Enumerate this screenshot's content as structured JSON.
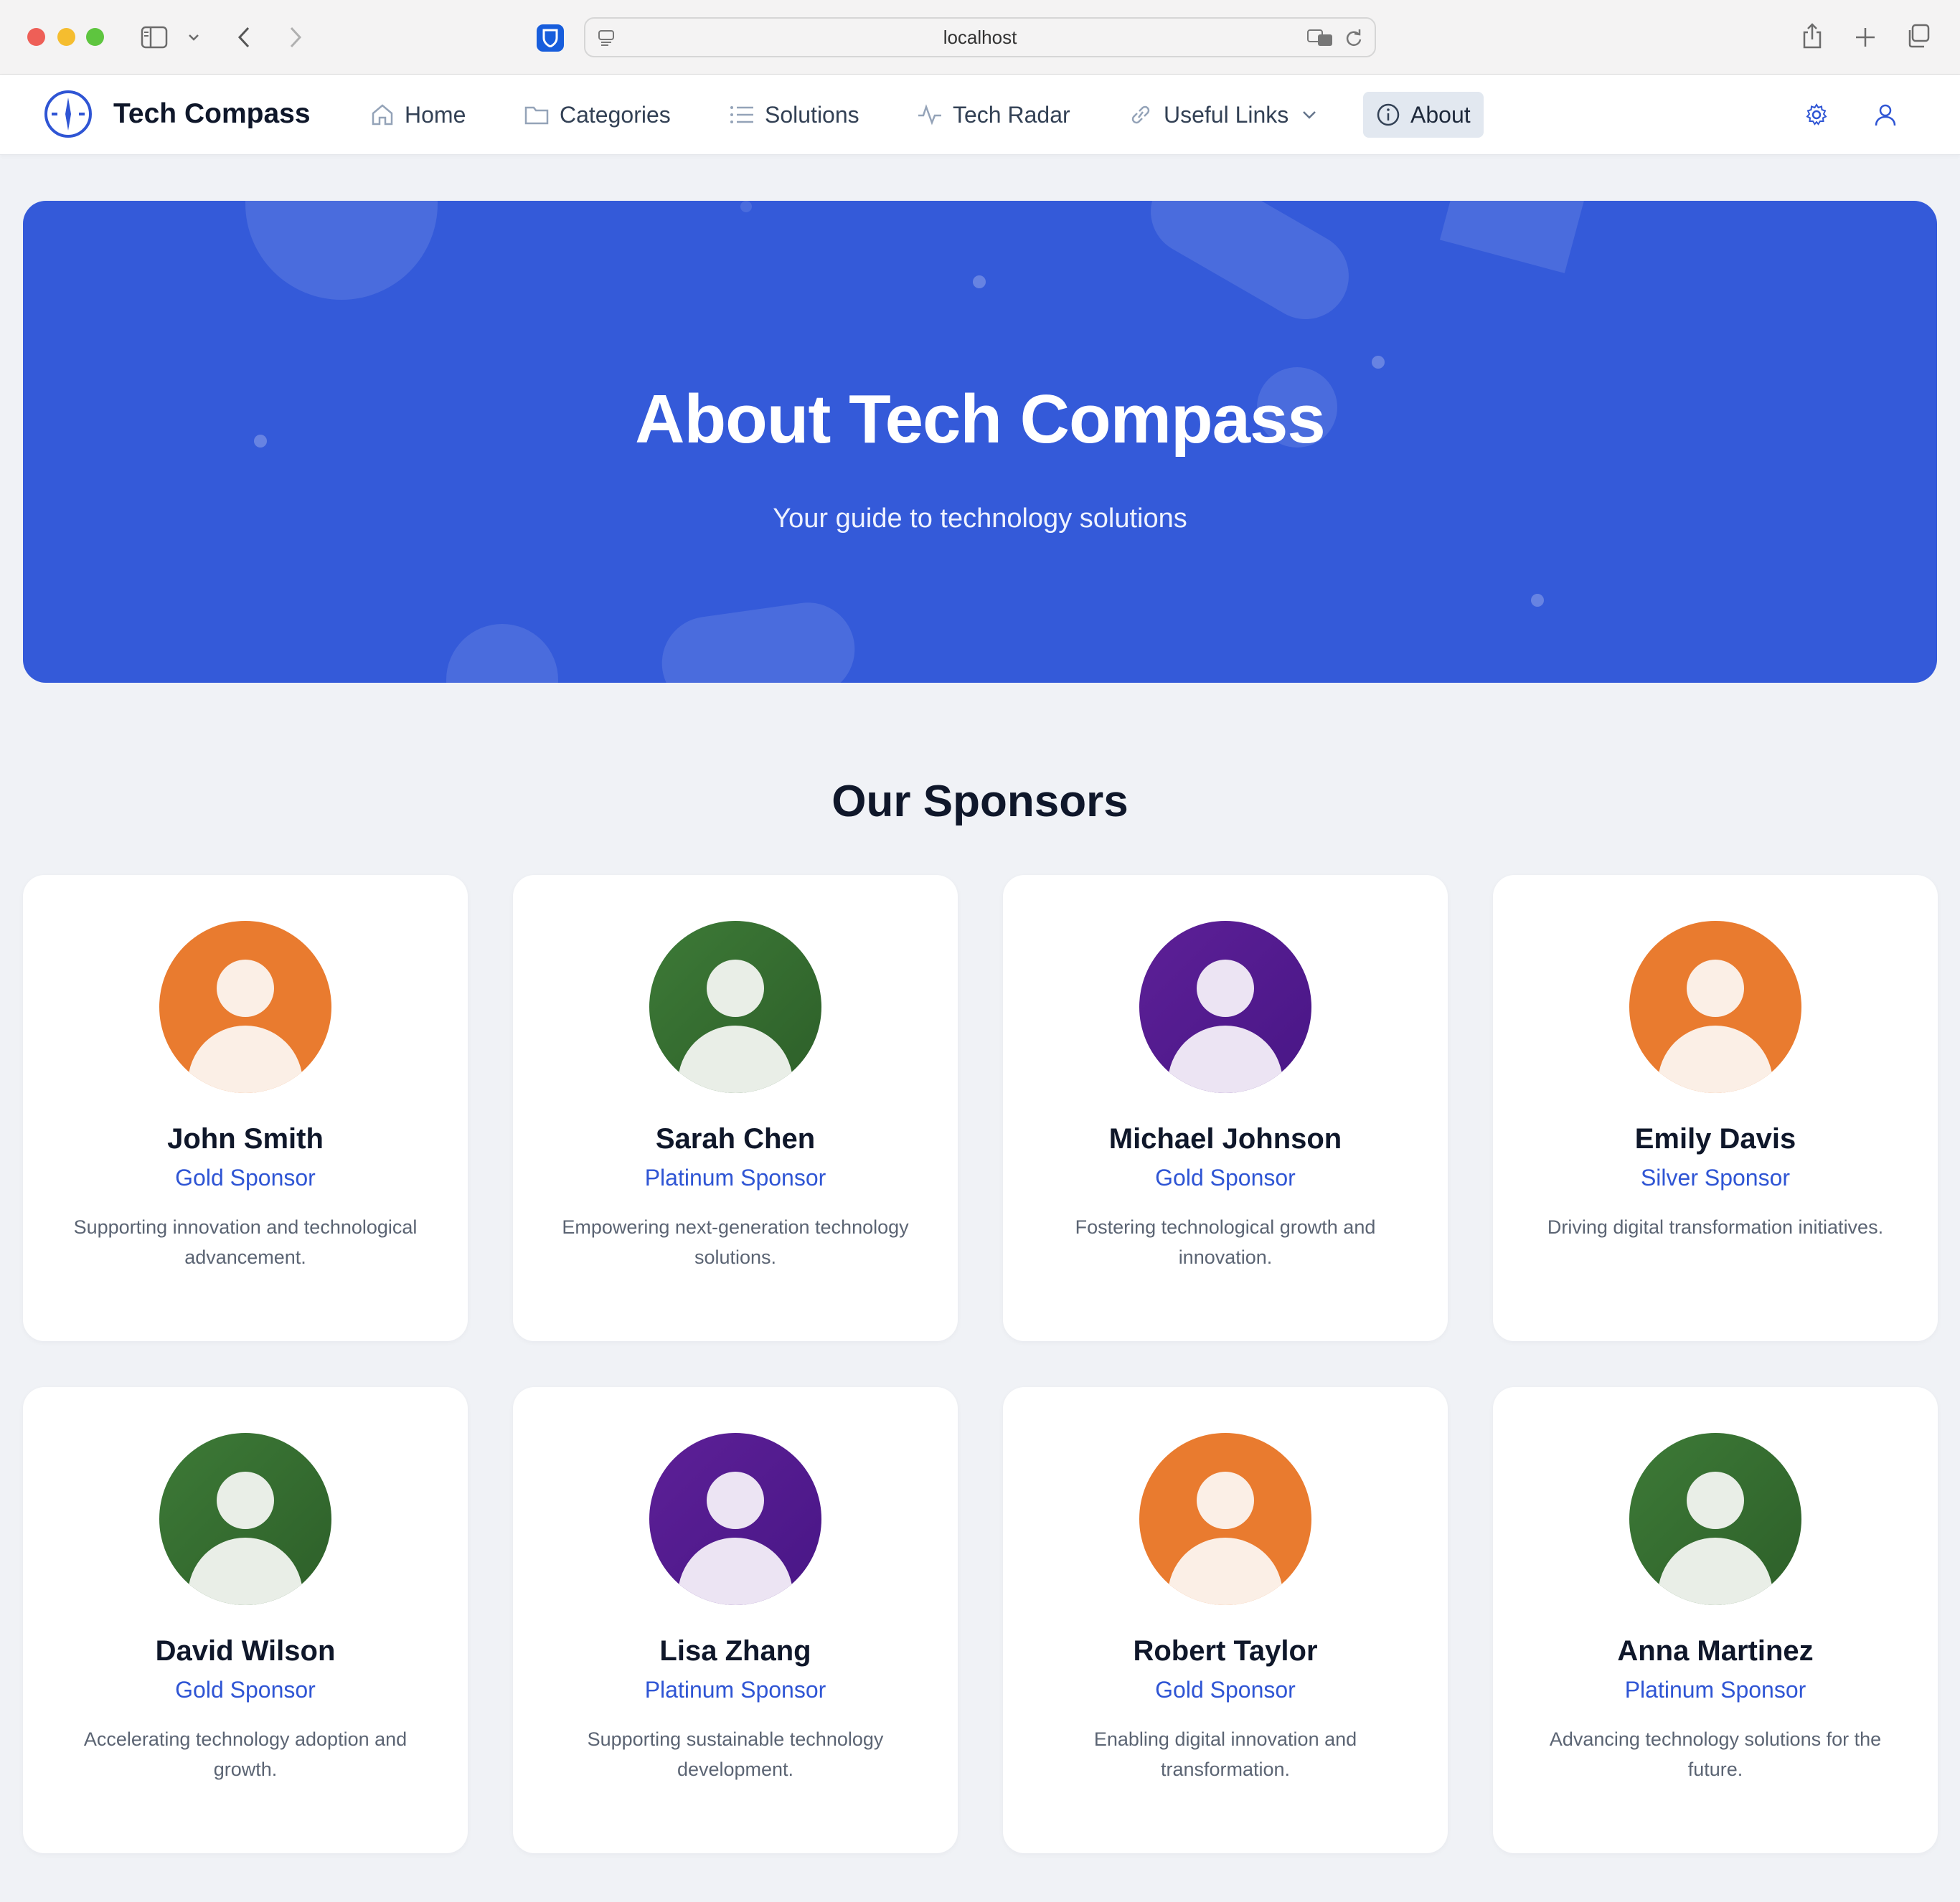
{
  "browser": {
    "url": "localhost"
  },
  "nav": {
    "brand": "Tech Compass",
    "items": [
      {
        "label": "Home",
        "icon": "home-icon"
      },
      {
        "label": "Categories",
        "icon": "folder-icon"
      },
      {
        "label": "Solutions",
        "icon": "list-icon"
      },
      {
        "label": "Tech Radar",
        "icon": "activity-icon"
      },
      {
        "label": "Useful Links",
        "icon": "link-icon"
      },
      {
        "label": "About",
        "icon": "info-icon"
      }
    ],
    "active": "About"
  },
  "hero": {
    "title": "About Tech Compass",
    "subtitle": "Your guide to technology solutions"
  },
  "sponsors": {
    "title": "Our Sponsors",
    "items": [
      {
        "name": "John Smith",
        "tier": "Gold Sponsor",
        "desc": "Supporting innovation and technological advancement.",
        "avatar_color": "#e97b2f"
      },
      {
        "name": "Sarah Chen",
        "tier": "Platinum Sponsor",
        "desc": "Empowering next-generation technology solutions.",
        "avatar_color": "#3d7a37"
      },
      {
        "name": "Michael Johnson",
        "tier": "Gold Sponsor",
        "desc": "Fostering technological growth and innovation.",
        "avatar_color": "#5d2097"
      },
      {
        "name": "Emily Davis",
        "tier": "Silver Sponsor",
        "desc": "Driving digital transformation initiatives.",
        "avatar_color": "#e97b2f"
      },
      {
        "name": "David Wilson",
        "tier": "Gold Sponsor",
        "desc": "Accelerating technology adoption and growth.",
        "avatar_color": "#3d7a37"
      },
      {
        "name": "Lisa Zhang",
        "tier": "Platinum Sponsor",
        "desc": "Supporting sustainable technology development.",
        "avatar_color": "#5d2097"
      },
      {
        "name": "Robert Taylor",
        "tier": "Gold Sponsor",
        "desc": "Enabling digital innovation and transformation.",
        "avatar_color": "#e97b2f"
      },
      {
        "name": "Anna Martinez",
        "tier": "Platinum Sponsor",
        "desc": "Advancing technology solutions for the future.",
        "avatar_color": "#3d7a37"
      }
    ]
  },
  "colors": {
    "accent": "#345ad9",
    "tier_text": "#2f55d4",
    "page_background": "#f0f2f6"
  }
}
